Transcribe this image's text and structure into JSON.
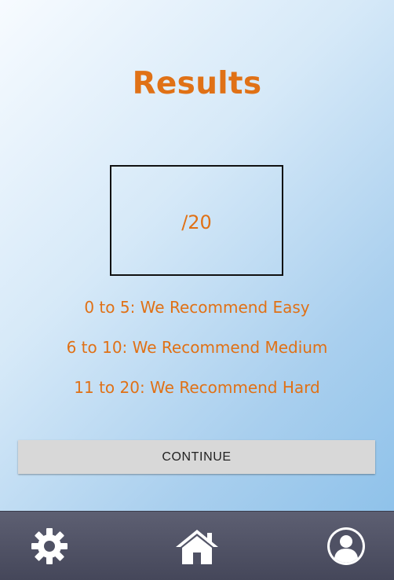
{
  "results": {
    "title": "Results",
    "score_display": "/20",
    "recommendations": [
      "0 to 5: We Recommend Easy",
      "6 to 10: We Recommend Medium",
      "11 to 20: We Recommend Hard"
    ],
    "continue_label": "CONTINUE"
  },
  "navbar": {
    "items": [
      {
        "icon": "gear-icon"
      },
      {
        "icon": "home-icon"
      },
      {
        "icon": "profile-icon"
      }
    ]
  },
  "colors": {
    "accent": "#e07116",
    "navbar": "#4f5164",
    "button": "#d8d8d8"
  }
}
